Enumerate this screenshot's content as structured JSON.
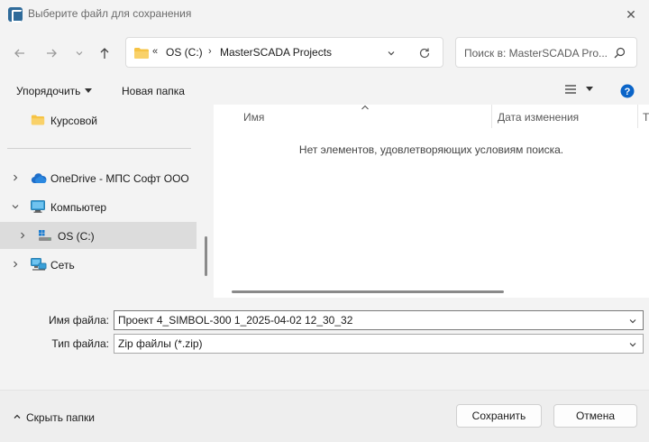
{
  "window": {
    "title": "Выберите файл для сохранения",
    "close_glyph": "✕"
  },
  "navigation": {
    "back_icon": "arrow-left-icon",
    "forward_icon": "arrow-right-icon",
    "recent_icon": "chevron-down-icon",
    "up_icon": "arrow-up-icon"
  },
  "address_bar": {
    "overflow": "«",
    "segments": [
      "OS (C:)",
      "MasterSCADA Projects"
    ],
    "separator": "›"
  },
  "search": {
    "placeholder": "Поиск в: MasterSCADA Pro..."
  },
  "command_bar": {
    "organize": "Упорядочить",
    "new_folder": "Новая папка"
  },
  "nav_tree": [
    {
      "label": "Курсовой",
      "icon": "folder-icon",
      "expandable": false,
      "selected": false
    },
    {
      "label": "OneDrive - МПС Софт ООО",
      "icon": "cloud-icon",
      "expandable": true,
      "expanded": false,
      "selected": false
    },
    {
      "label": "Компьютер",
      "icon": "monitor-icon",
      "expandable": true,
      "expanded": true,
      "selected": false
    },
    {
      "label": "OS (C:)",
      "icon": "drive-icon",
      "expandable": true,
      "expanded": false,
      "selected": true
    },
    {
      "label": "Сеть",
      "icon": "network-icon",
      "expandable": true,
      "expanded": false,
      "selected": false
    }
  ],
  "file_list": {
    "columns": [
      "Имя",
      "Дата изменения",
      "Т"
    ],
    "empty_message": "Нет элементов, удовлетворяющих условиям поиска."
  },
  "form": {
    "filename_label": "Имя файла:",
    "filename_value": "Проект 4_SIMBOL-300 1_2025-04-02 12_30_32",
    "filetype_label": "Тип файла:",
    "filetype_value": "Zip файлы (*.zip)"
  },
  "footer": {
    "hide_folders": "Скрыть папки",
    "save": "Сохранить",
    "cancel": "Отмена"
  },
  "colors": {
    "accent": "#1a73c8",
    "folder": "#f6c344",
    "help": "#0a64c8"
  }
}
